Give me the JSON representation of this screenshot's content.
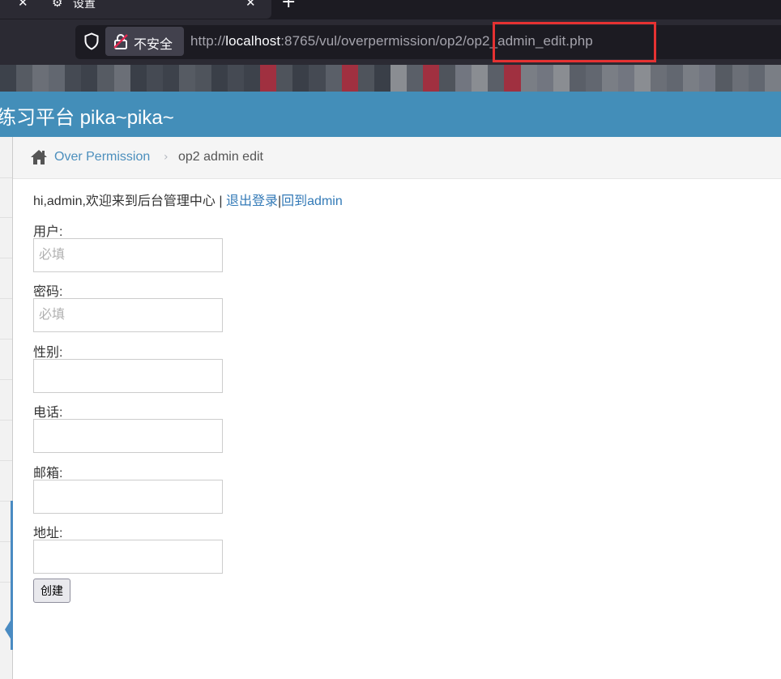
{
  "browser": {
    "tab_title": "设置",
    "security_label": "不安全",
    "url_prefix": "http://",
    "url_host": "localhost",
    "url_path": ":8765/vul/overpermission/op2/op2_admin_edit.php"
  },
  "site": {
    "title": "练习平台 pika~pika~"
  },
  "breadcrumb": {
    "parent": "Over Permission",
    "current": "op2 admin edit"
  },
  "welcome": {
    "text": "hi,admin,欢迎来到后台管理中心 | ",
    "logout": "退出登录",
    "separator": "|",
    "back": "回到admin"
  },
  "form": {
    "fields": [
      {
        "label": "用户:",
        "placeholder": "必填",
        "value": ""
      },
      {
        "label": "密码:",
        "placeholder": "必填",
        "value": ""
      },
      {
        "label": "性别:",
        "placeholder": "",
        "value": ""
      },
      {
        "label": "电话:",
        "placeholder": "",
        "value": ""
      },
      {
        "label": "邮箱:",
        "placeholder": "",
        "value": ""
      },
      {
        "label": "地址:",
        "placeholder": "",
        "value": ""
      }
    ],
    "submit_label": "创建"
  },
  "colors": {
    "header_blue": "#438eb9",
    "link_blue": "#337ab7",
    "highlight_red": "#e63232"
  }
}
